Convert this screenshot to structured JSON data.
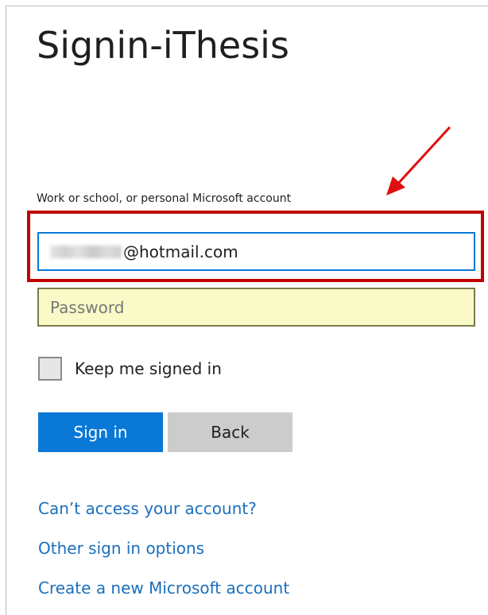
{
  "page": {
    "title": "Signin-iThesis",
    "account_label": "Work or school, or personal Microsoft account"
  },
  "form": {
    "email_suffix": "@hotmail.com",
    "password_placeholder": "Password",
    "keep_signed_in_label": "Keep me signed in"
  },
  "buttons": {
    "sign_in": "Sign in",
    "back": "Back"
  },
  "links": {
    "cant_access": "Can’t access your account?",
    "other_options": "Other sign in options",
    "create_account": "Create a new Microsoft account"
  },
  "colors": {
    "accent": "#0a78d7",
    "link": "#1a6fbd",
    "annotation": "#c00000",
    "arrow": "#e01010",
    "password_bg": "#fafac8"
  }
}
